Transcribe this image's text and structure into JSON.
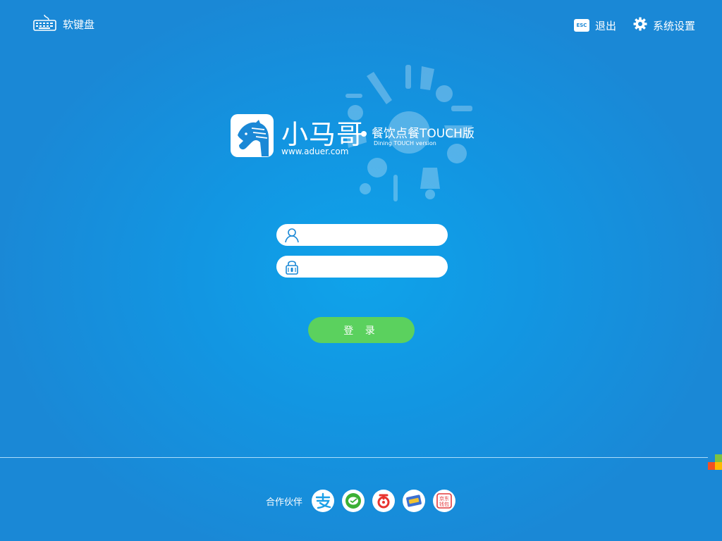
{
  "topbar": {
    "keyboard_label": "软键盘",
    "esc_key_label": "ESC",
    "exit_label": "退出",
    "settings_label": "系统设置"
  },
  "brand": {
    "name": "小马哥",
    "url": "www.aduer.com",
    "product_title": "餐饮点餐TOUCH版",
    "product_subtitle": "Dining TOUCH version"
  },
  "login": {
    "username_value": "",
    "password_value": "",
    "button_label": "登 录"
  },
  "partners": {
    "label": "合作伙伴",
    "items": [
      {
        "name": "alipay-icon",
        "color": "#1aa0e8"
      },
      {
        "name": "wechat-pay-icon",
        "color": "#3cb035"
      },
      {
        "name": "baidu-wallet-icon",
        "color": "#e8332e"
      },
      {
        "name": "card-pay-icon",
        "color": "#3b6fd1"
      },
      {
        "name": "jd-wallet-icon",
        "color": "#e4393c",
        "text": "京东钱包"
      }
    ]
  },
  "colors": {
    "background": "#1296e2",
    "login_button": "#5bd15e",
    "field_icon": "#1a88d6"
  }
}
